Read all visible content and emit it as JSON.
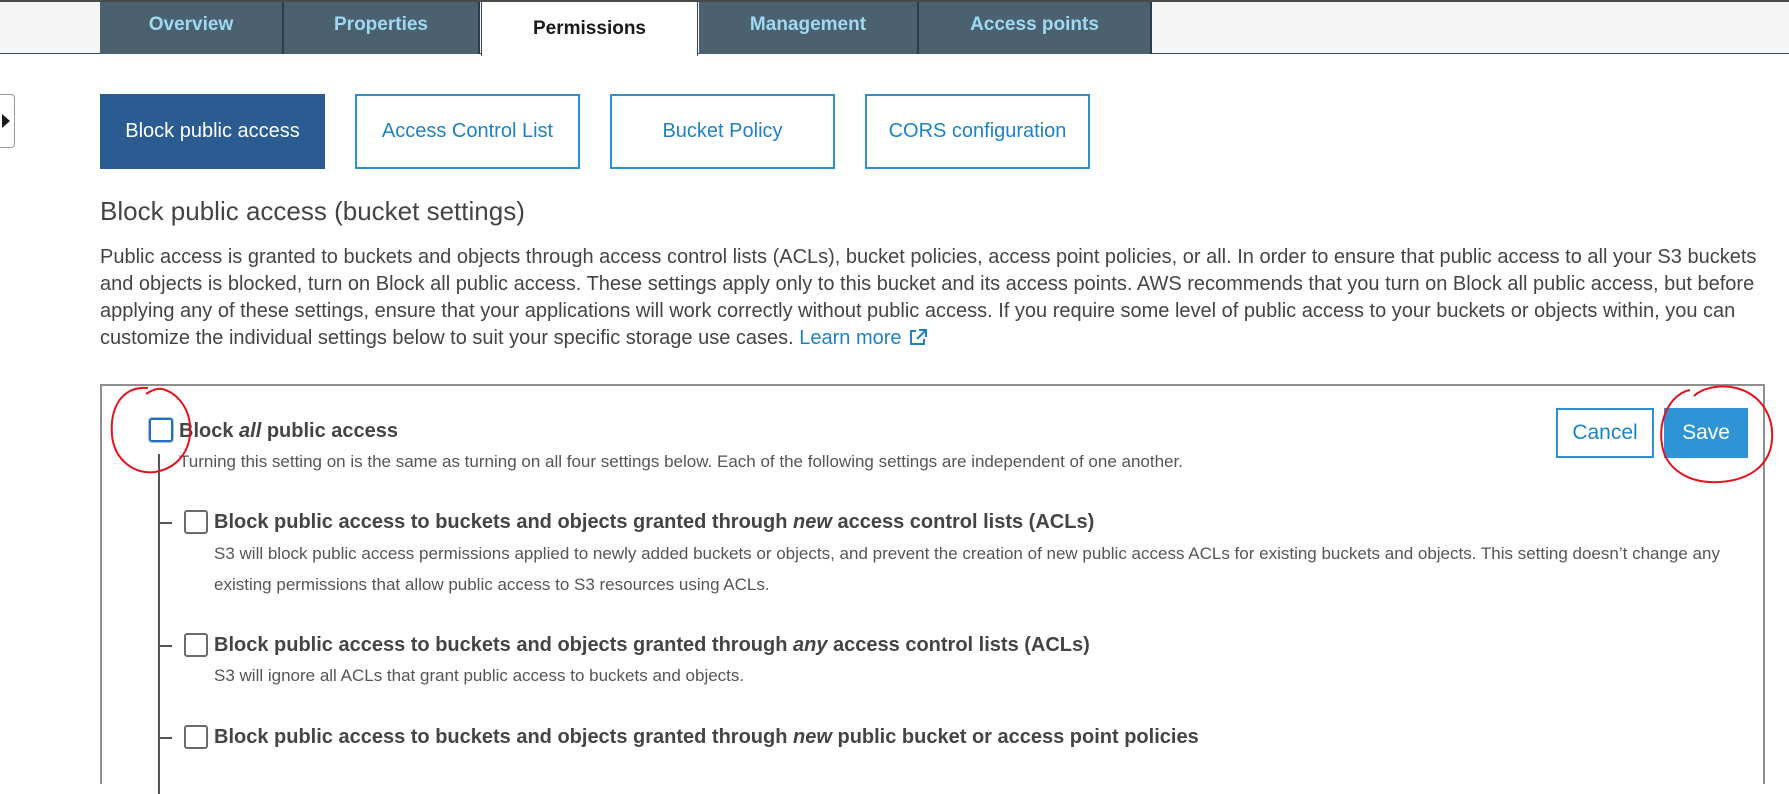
{
  "tabs": [
    {
      "label": "Overview"
    },
    {
      "label": "Properties"
    },
    {
      "label": "Permissions"
    },
    {
      "label": "Management"
    },
    {
      "label": "Access points"
    }
  ],
  "subtabs": [
    {
      "label": "Block public access"
    },
    {
      "label": "Access Control List"
    },
    {
      "label": "Bucket Policy"
    },
    {
      "label": "CORS configuration"
    }
  ],
  "section": {
    "title": "Block public access (bucket settings)",
    "description": "Public access is granted to buckets and objects through access control lists (ACLs), bucket policies, access point policies, or all. In order to ensure that public access to all your S3 buckets and objects is blocked, turn on Block all public access. These settings apply only to this bucket and its access points. AWS recommends that you turn on Block all public access, but before applying any of these settings, ensure that your applications will work correctly without public access. If you require some level of public access to your buckets or objects within, you can customize the individual settings below to suit your specific storage use cases.",
    "learn_more": "Learn more"
  },
  "panel": {
    "main_title_pre": "Block ",
    "main_title_em": "all",
    "main_title_post": " public access",
    "main_desc": "Turning this setting on is the same as turning on all four settings below. Each of the following settings are independent of one another.",
    "cancel_label": "Cancel",
    "save_label": "Save",
    "settings": [
      {
        "title_pre": "Block public access to buckets and objects granted through ",
        "title_em": "new",
        "title_post": " access control lists (ACLs)",
        "desc": "S3 will block public access permissions applied to newly added buckets or objects, and prevent the creation of new public access ACLs for existing buckets and objects. This setting doesn’t change any existing permissions that allow public access to S3 resources using ACLs."
      },
      {
        "title_pre": "Block public access to buckets and objects granted through ",
        "title_em": "any",
        "title_post": " access control lists (ACLs)",
        "desc": "S3 will ignore all ACLs that grant public access to buckets and objects."
      },
      {
        "title_pre": "Block public access to buckets and objects granted through ",
        "title_em": "new",
        "title_post": " public bucket or access point policies",
        "desc": ""
      }
    ]
  },
  "colors": {
    "tab_bg": "#4b6170",
    "tab_text": "#9fd9f1",
    "active_subtab": "#2a5b91",
    "link": "#1d82c4",
    "save_button": "#2e94d6",
    "annotation": "#e0141e"
  },
  "icons": {
    "side_toggle": "caret-right-icon",
    "learn_more": "external-link-icon"
  }
}
